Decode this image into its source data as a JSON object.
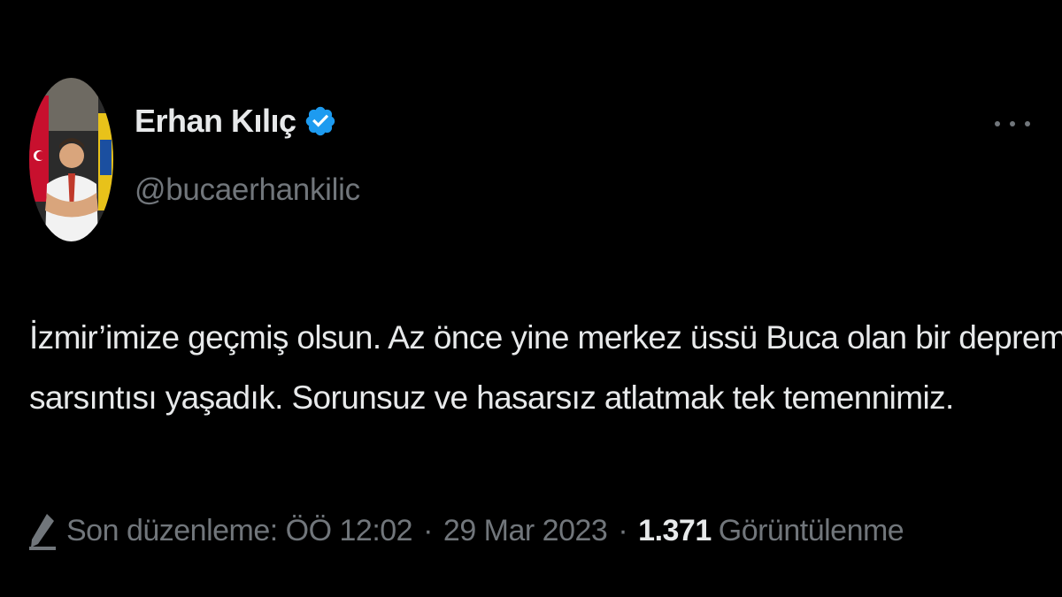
{
  "author": {
    "display_name": "Erhan Kılıç",
    "handle": "@bucaerhankilic",
    "verified_icon": "verified-badge-icon",
    "verified_color": "#1d9bf0"
  },
  "tweet": {
    "lines": [
      "İzmir’imize geçmiş olsun. Az önce yine merkez üssü Buca olan bir deprem",
      "sarsıntısı yaşadık. Sorunsuz ve hasarsız atlatmak tek temennimiz."
    ]
  },
  "meta": {
    "edited_label": "Son düzenleme: ÖÖ 12:02",
    "separator": "·",
    "date": "29 Mar 2023",
    "views_count": "1.371",
    "views_label": "Görüntülenme"
  },
  "colors": {
    "background": "#000000",
    "primary_text": "#e7e9ea",
    "secondary_text": "#71767b",
    "accent": "#1d9bf0"
  },
  "icons": {
    "more": "more-options-icon",
    "edit": "edit-pencil-icon"
  }
}
